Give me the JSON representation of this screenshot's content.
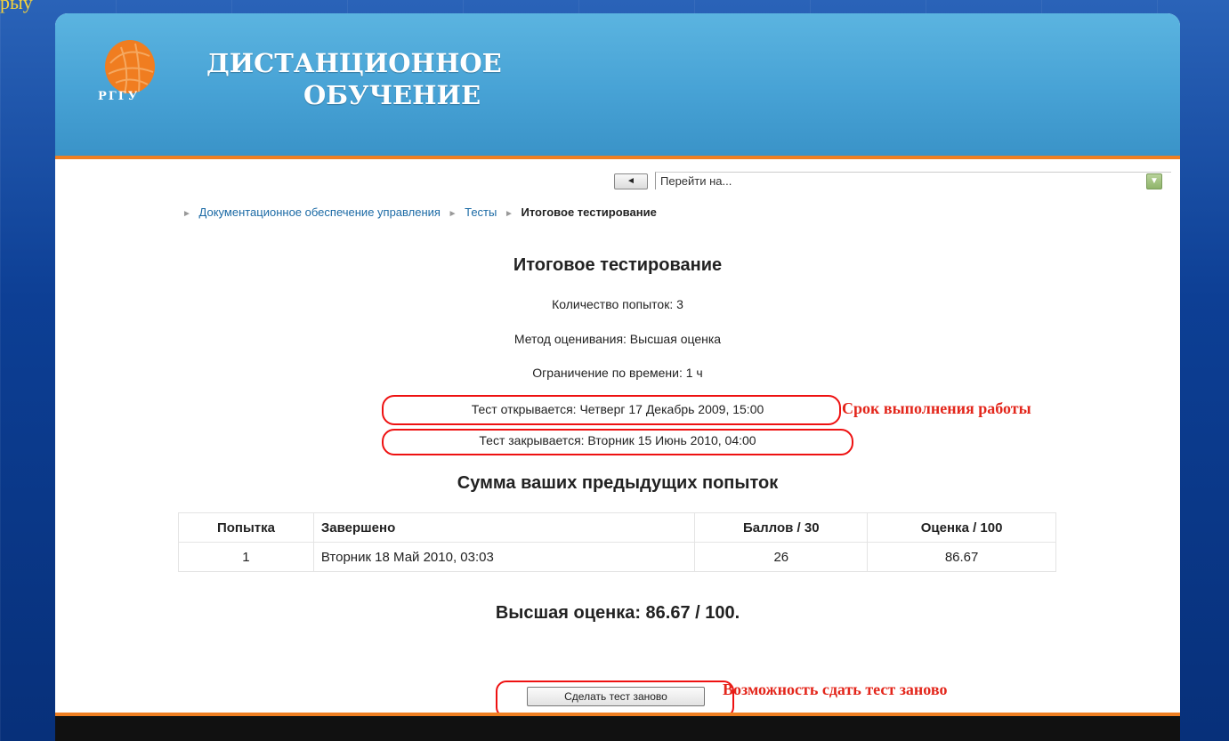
{
  "corner_text": "рыу",
  "site": {
    "title_line1": "ДИСТАНЦИОННОЕ",
    "title_line2": "ОБУЧЕНИЕ",
    "logo_text": "РГГУ"
  },
  "nav": {
    "back_label": "◄",
    "jump_placeholder": "Перейти на..."
  },
  "breadcrumb": {
    "items": [
      "Документационное обеспечение управления",
      "Тесты"
    ],
    "current": "Итоговое тестирование"
  },
  "quiz": {
    "title": "Итоговое тестирование",
    "attempts_allowed": "Количество попыток: 3",
    "grading_method": "Метод оценивания: Высшая оценка",
    "time_limit": "Ограничение по времени: 1 ч",
    "opens": "Тест открывается: Четверг 17 Декабрь 2009, 15:00",
    "closes": "Тест закрывается: Вторник 15 Июнь 2010, 04:00"
  },
  "summary": {
    "title": "Сумма ваших предыдущих попыток",
    "headers": [
      "Попытка",
      "Завершено",
      "Баллов / 30",
      "Оценка / 100"
    ],
    "rows": [
      [
        "1",
        "Вторник 18 Май 2010, 03:03",
        "26",
        "86.67"
      ]
    ],
    "best_grade": "Высшая оценка: 86.67 / 100."
  },
  "retake_button": "Сделать тест заново",
  "annotations": {
    "deadline": "Срок выполнения работы",
    "retake": "Возможность сдать тест заново"
  },
  "colors": {
    "header": "#4aa6d8",
    "accent": "#ef7f22",
    "annotation": "#e3261b",
    "link": "#1b6aa5"
  }
}
